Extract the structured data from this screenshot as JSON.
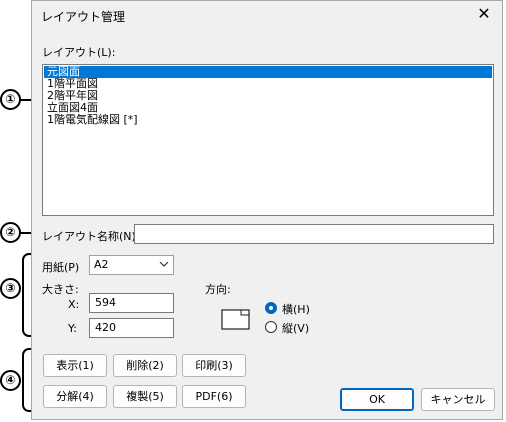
{
  "dialog": {
    "title": "レイアウト管理"
  },
  "layout_list": {
    "label": "レイアウト(L):",
    "items": [
      "元図面",
      "1階平面図",
      "2階平年図",
      "立面図4面",
      "1階電気配線図 [*]"
    ],
    "selected_index": 0
  },
  "layout_name": {
    "label": "レイアウト名称(N):",
    "value": ""
  },
  "paper": {
    "label": "用紙(P)",
    "value": "A2",
    "size_label": "大きさ:",
    "x_label": "X:",
    "x_value": "594",
    "y_label": "Y:",
    "y_value": "420"
  },
  "orientation": {
    "label": "方向:",
    "landscape": "横(H)",
    "portrait": "縦(V)",
    "selected": "landscape"
  },
  "buttons": {
    "display": "表示(1)",
    "delete": "削除(2)",
    "print": "印刷(3)",
    "split": "分解(4)",
    "duplicate": "複製(5)",
    "pdf": "PDF(6)",
    "ok": "OK",
    "cancel": "キャンセル"
  },
  "markers": [
    "①",
    "②",
    "③",
    "④"
  ],
  "colors": {
    "selection": "#0078d7",
    "accent": "#0067c0"
  }
}
